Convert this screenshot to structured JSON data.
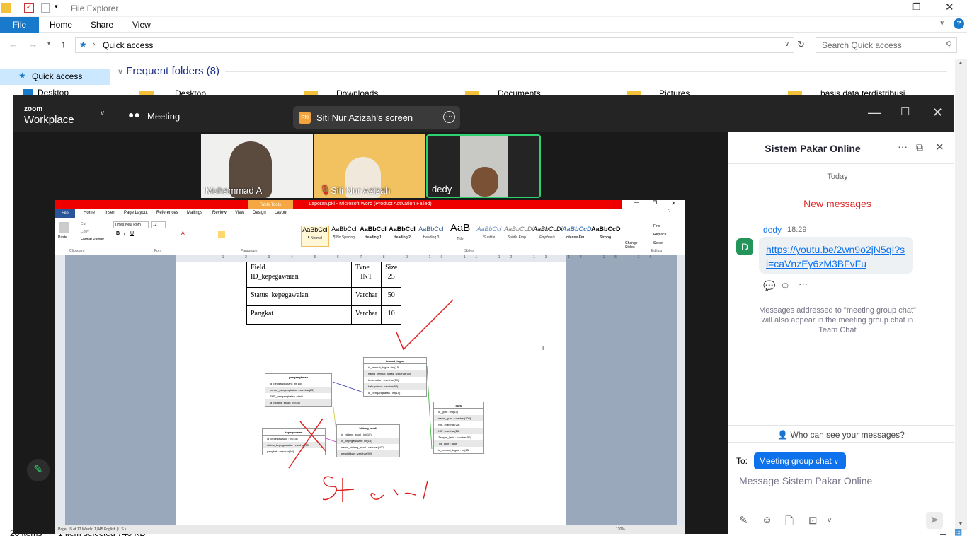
{
  "explorer": {
    "title": "File Explorer",
    "tabs": {
      "file": "File",
      "home": "Home",
      "share": "Share",
      "view": "View"
    },
    "address": "Quick access",
    "search_placeholder": "Search Quick access",
    "nav_quick_access": "Quick access",
    "nav_desktop": "Desktop",
    "frequent_folders": "Frequent folders (8)",
    "folders": [
      "Desktop",
      "Downloads",
      "Documents",
      "Pictures",
      "basis data terdistribusi"
    ],
    "status_items": "20 items",
    "status_selected": "1 item selected  746 KB"
  },
  "zoom": {
    "logo_top": "zoom",
    "logo_bottom": "Workplace",
    "meeting_label": "Meeting",
    "share_initials": "SN",
    "share_label": "Siti Nur Azizah's screen",
    "participants": [
      {
        "name": "Muhammad A"
      },
      {
        "name": "Siti Nur Azizah"
      },
      {
        "name": "dedy"
      }
    ]
  },
  "word": {
    "title": "Laporan.pkl - Microsoft Word (Product Activation Failed)",
    "table_tools": "Table Tools",
    "tabs": [
      "File",
      "Home",
      "Insert",
      "Page Layout",
      "References",
      "Mailings",
      "Review",
      "View",
      "Design",
      "Layout"
    ],
    "clipboard": {
      "paste": "Paste",
      "cut": "Cut",
      "copy": "Copy",
      "painter": "Format Painter",
      "group": "Clipboard"
    },
    "font_name": "Times New Rom",
    "font_size": "12",
    "group_font": "Font",
    "group_paragraph": "Paragraph",
    "group_styles": "Styles",
    "group_editing": "Editing",
    "styles": [
      {
        "sample": "AaBbCcI",
        "name": "¶ Normal"
      },
      {
        "sample": "AaBbCcI",
        "name": "¶ No Spacing"
      },
      {
        "sample": "AaBbCcI",
        "name": "Heading 1"
      },
      {
        "sample": "AaBbCcI",
        "name": "Heading 2"
      },
      {
        "sample": "AaBbCcI",
        "name": "Heading 3"
      },
      {
        "sample": "AaB",
        "name": "Title"
      },
      {
        "sample": "AaBbCci",
        "name": "Subtitle"
      },
      {
        "sample": "AaBbCcDi",
        "name": "Subtle Emp..."
      },
      {
        "sample": "AaBbCcDi",
        "name": "Emphasis"
      },
      {
        "sample": "AaBbCcD",
        "name": "Intense Em..."
      },
      {
        "sample": "AaBbCcD",
        "name": "Strong"
      }
    ],
    "change_styles": "Change Styles",
    "editing": {
      "find": "Find",
      "replace": "Replace",
      "select": "Select"
    },
    "table": {
      "header": [
        "Field",
        "Type",
        "Size"
      ],
      "rows": [
        [
          "ID_kepegawaian",
          "INT",
          "25"
        ],
        [
          "Status_kepegawaian",
          "Varchar",
          "50"
        ],
        [
          "Pangkat",
          "Varchar",
          "10"
        ]
      ]
    },
    "erd": {
      "tempat_tugas": {
        "title": "tempat_tugas",
        "rows": [
          "id_tempat_tugas : int(15)",
          "nama_tempat_tugas : varchar(50)",
          "kecamatan : varchar(50)",
          "kabupaten : varchar(50)",
          "id_pengangkatan : int(15)"
        ]
      },
      "pengangkatan": {
        "title": "pengangkatan",
        "rows": [
          "id_pengangkatan : int(15)",
          "nomor_pengangkatan : varchar(25)",
          "TMT_pengangkatan : date",
          "id_bidang_studi : int(15)"
        ]
      },
      "kepegawaian": {
        "title": "kepegawaian",
        "rows": [
          "id_kepegawaian : int(15)",
          "status_kepegawaian : varchar(50)",
          "pangkat : varchar(10)"
        ]
      },
      "bidang_studi": {
        "title": "bidang_studi",
        "rows": [
          "id_bidang_studi : int(15)",
          "id_kepegawaian : int(15)",
          "nama_bidang_studi : varchar(100)",
          "pendidikan : varchar(50)"
        ]
      },
      "guru": {
        "title": "guru",
        "rows": [
          "id_guru : int(15)",
          "nama_guru : varchar(100)",
          "NIK : varchar(25)",
          "NIP : varchar(25)",
          "Tempat_lahir : varchar(50)",
          "Tgl_lahir : date",
          "id_tempat_tugas : int(15)"
        ]
      }
    },
    "status": "Page: 15 of 17   Words: 1,845   English (U.S.)",
    "zoom_level": "120%"
  },
  "chat": {
    "title": "Sistem Pakar Online",
    "today": "Today",
    "new_messages": "New messages",
    "avatar_initial": "D",
    "sender": "dedy",
    "time": "18:29",
    "message": "https://youtu.be/2wn9o2jN5qI?si=caVnzEy6zM3BFvFu",
    "note": "Messages addressed to \"meeting group chat\" will also appear in the meeting group chat in Team Chat",
    "who_can_see": "Who can see your messages?",
    "to_label": "To:",
    "recipient": "Meeting group chat",
    "input_placeholder": "Message Sistem Pakar Online"
  },
  "colors": {
    "explorer_blue": "#1979ca",
    "zoom_blue": "#0e72ed",
    "word_red": "#e00000",
    "new_msg_red": "#e02828",
    "avatar_green": "#23955a"
  }
}
